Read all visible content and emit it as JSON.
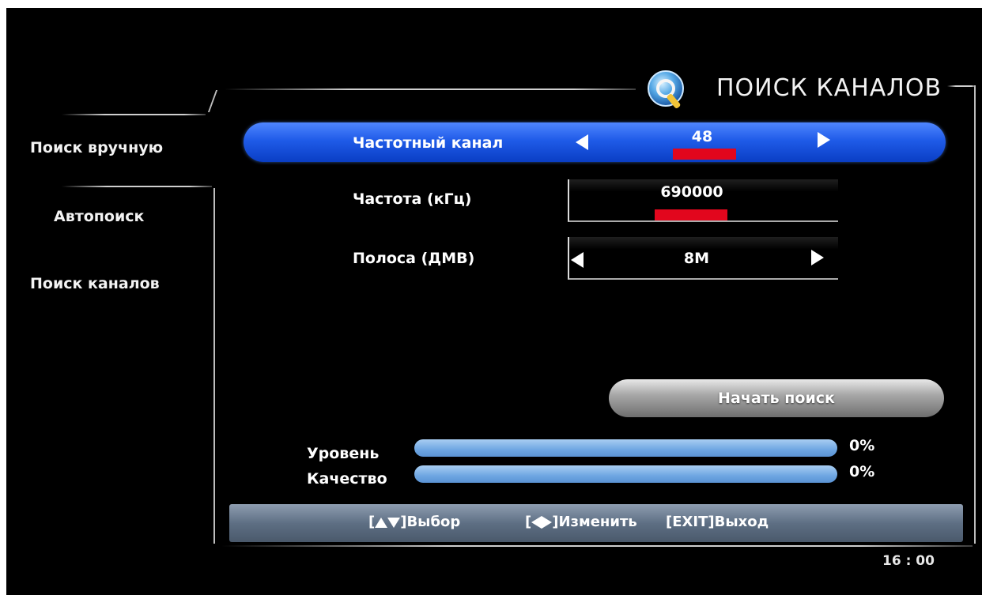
{
  "header": {
    "title": "ПОИСК КАНАЛОВ",
    "icon": "search-magnifier-icon"
  },
  "sidebar": {
    "items": [
      {
        "label": "Поиск вручную",
        "selected": true
      },
      {
        "label": "Автопоиск",
        "selected": false
      },
      {
        "label": "Поиск каналов",
        "selected": false
      }
    ]
  },
  "settings": {
    "channel": {
      "label": "Частотный канал",
      "value": "48"
    },
    "frequency": {
      "label": "Частота (кГц)",
      "value": "690000"
    },
    "bandwidth": {
      "label": "Полоса (ДМВ)",
      "value": "8M"
    }
  },
  "start_button": {
    "label": "Начать поиск"
  },
  "meters": {
    "level": {
      "label": "Уровень",
      "percent_text": "0%",
      "value": 0
    },
    "quality": {
      "label": "Качество",
      "percent_text": "0%",
      "value": 0
    }
  },
  "help": {
    "select_open": "[",
    "select_label": "]Выбор",
    "change_open": "[",
    "change_label": "]Изменить",
    "exit_label": "[EXIT]Выход"
  },
  "clock": "16 : 00",
  "colors": {
    "selected_row": "#1f5be8",
    "marker": "#e2061d",
    "help_bar": "#5e6f84",
    "meter_bar": "#6ea6e2"
  }
}
